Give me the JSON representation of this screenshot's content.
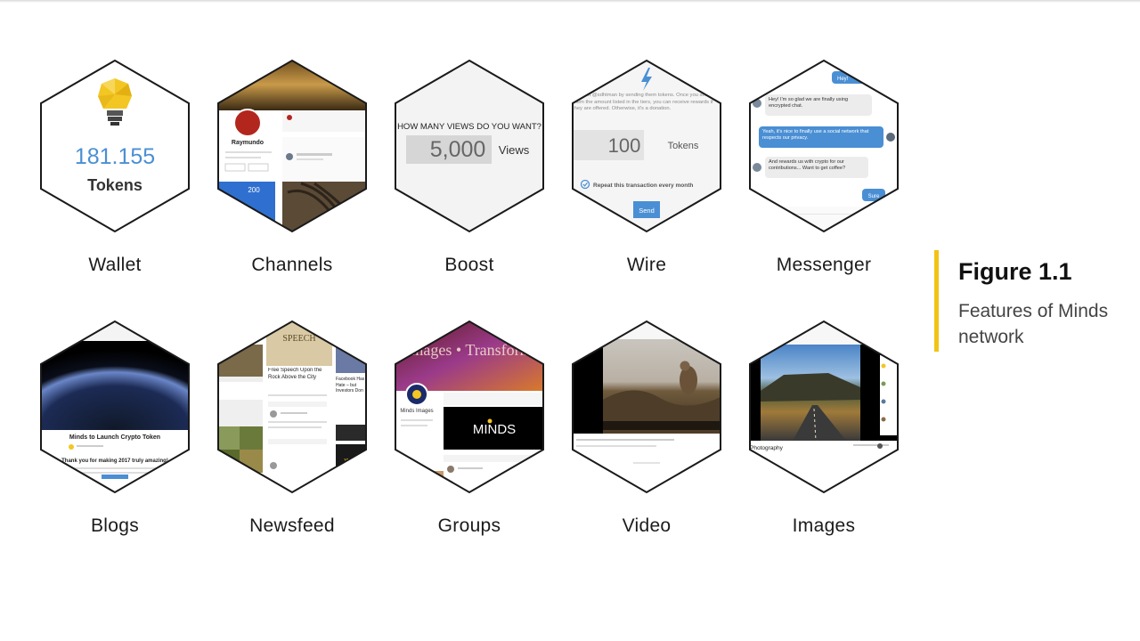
{
  "colors": {
    "accent_blue": "#4a8fd4",
    "caption_bar": "#f2c314",
    "hex_stroke": "#1a1a1a"
  },
  "features": [
    {
      "label": "Wallet"
    },
    {
      "label": "Channels"
    },
    {
      "label": "Boost"
    },
    {
      "label": "Wire"
    },
    {
      "label": "Messenger"
    },
    {
      "label": "Blogs"
    },
    {
      "label": "Newsfeed"
    },
    {
      "label": "Groups"
    },
    {
      "label": "Video"
    },
    {
      "label": "Images"
    }
  ],
  "wallet": {
    "amount": "181.155",
    "unit": "Tokens",
    "icon": "lightbulb-icon"
  },
  "channels": {
    "name": "Raymundo",
    "count": "200"
  },
  "boost": {
    "question": "HOW MANY VIEWS DO YOU WANT?",
    "value": "5,000",
    "unit": "Views"
  },
  "wire": {
    "intro": "Support @sdhtman by sending them tokens. Once you send them the amount listed in the tiers, you can receive rewards if they are offered. Otherwise, it's a donation.",
    "amount": "100",
    "unit": "Tokens",
    "repeat": "Repeat this transaction every month",
    "send": "Send",
    "icon": "bolt-icon"
  },
  "messenger": {
    "messages": [
      {
        "text": "Hey!",
        "side": "right"
      },
      {
        "text": "Hey! I'm so glad we are finally using encrypted chat.",
        "side": "left"
      },
      {
        "text": "Yeah, it's nice to finally use a social network that respects our privacy.",
        "side": "right"
      },
      {
        "text": "And rewards us with crypto for our contributions... Want to get coffee?",
        "side": "left"
      },
      {
        "text": "Sure",
        "side": "right"
      }
    ]
  },
  "blogs": {
    "title": "Minds to Launch Crypto Token",
    "body": "Thank you for making 2017 truly amazing!"
  },
  "newsfeed": {
    "post_title": "Free Speech Upon the Rock Above the City",
    "side_title": "Facebook Has Hate – but Investors Don",
    "banner": "SPEECH"
  },
  "groups": {
    "banner": "Minds • Images • Transform • Create",
    "group_name": "Minds Images",
    "logo": "MINDS"
  },
  "images": {
    "caption": "Photography"
  },
  "caption": {
    "title": "Figure 1.1",
    "subtitle": "Features of Minds network"
  }
}
